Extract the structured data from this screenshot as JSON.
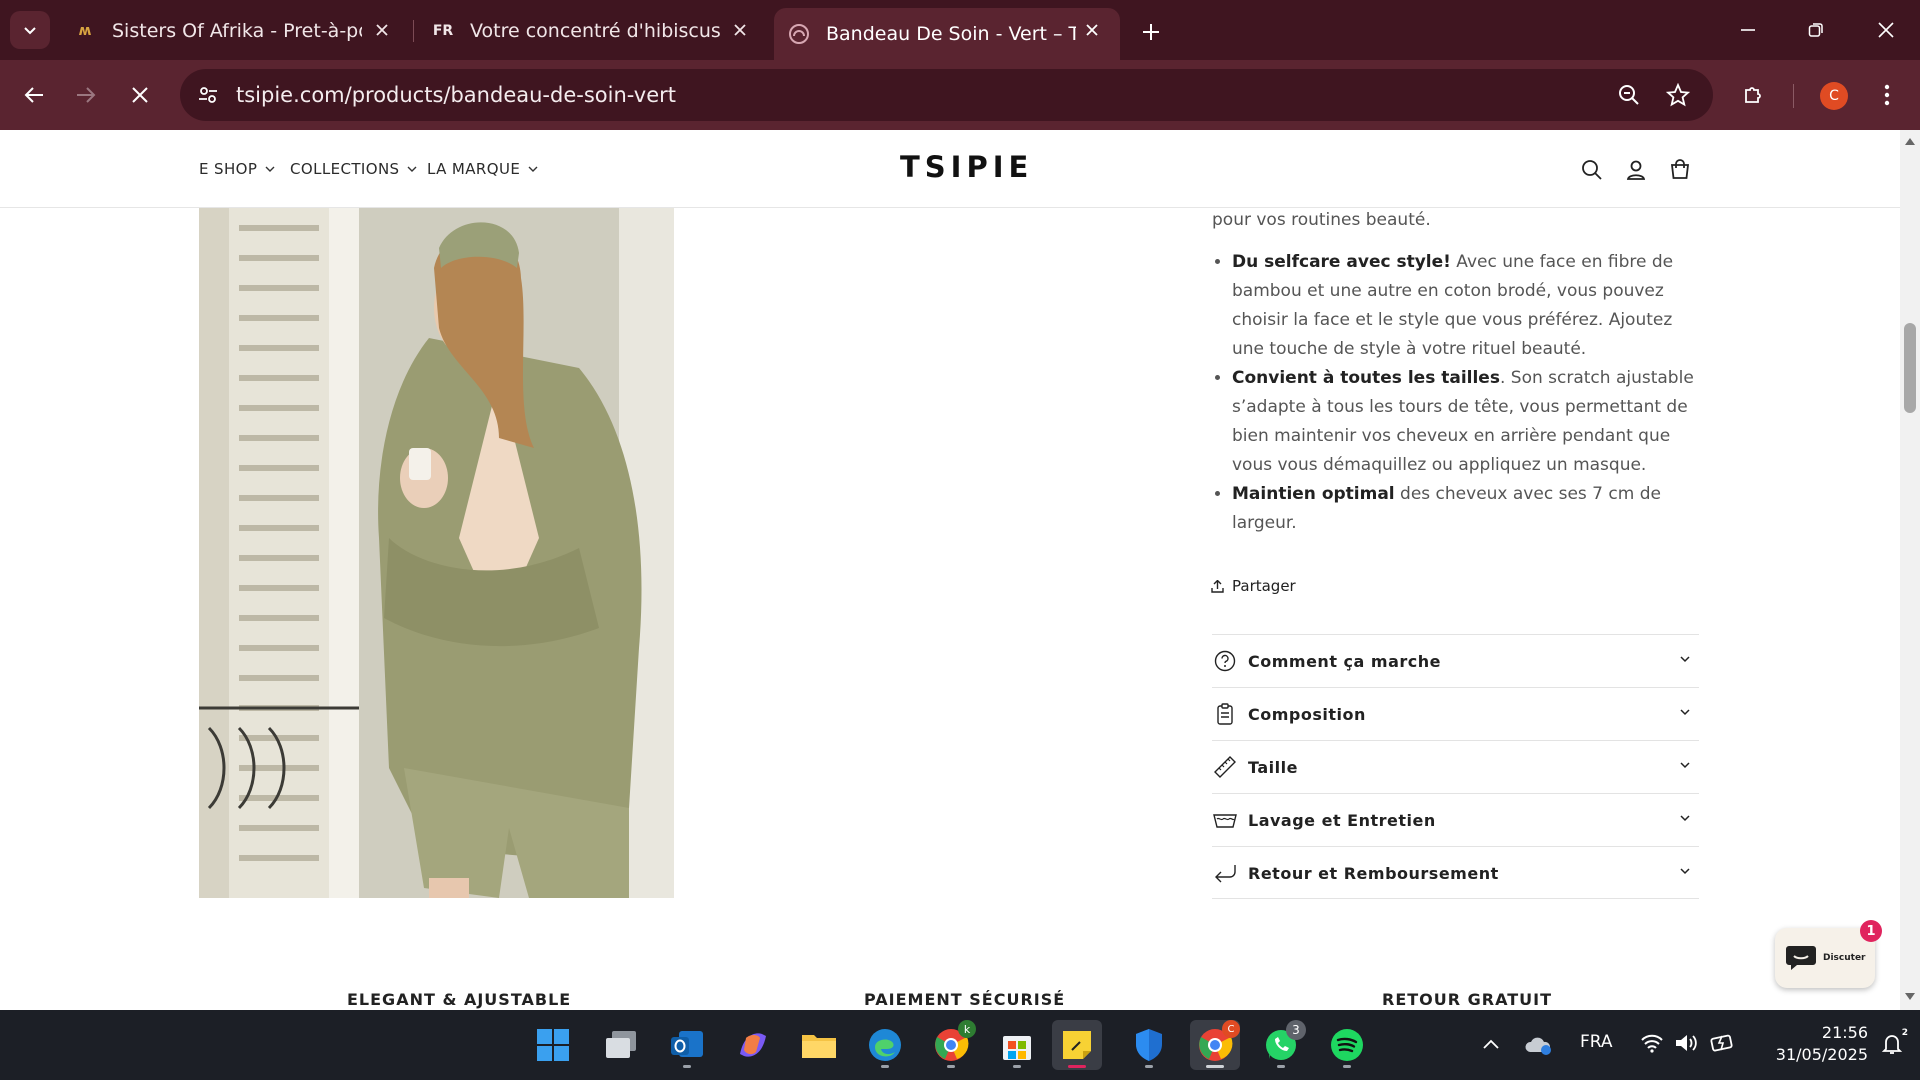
{
  "browser": {
    "tabs": [
      {
        "title": "Sisters Of Afrika - Pret-à-porter",
        "favicon": "sisters-logo-icon"
      },
      {
        "title": "Votre concentré d'hibiscus natu",
        "favicon_text": "FR"
      },
      {
        "title": "Bandeau De Soin - Vert – TSIPIE",
        "favicon": "tsipie-icon",
        "active": true
      }
    ],
    "url": "tsipie.com/products/bandeau-de-soin-vert",
    "profile_initial": "C",
    "accent": "#5a2430"
  },
  "site": {
    "logo": "TSIPIE",
    "nav": [
      "E SHOP",
      "COLLECTIONS",
      "LA MARQUE"
    ]
  },
  "product": {
    "intro": "pour vos routines beauté.",
    "features": [
      {
        "bold": "Du selfcare avec style!",
        "text": " Avec une face en fibre de bambou et une autre en coton brodé, vous pouvez choisir la face et le style que vous préférez. Ajoutez une touche de style à votre rituel beauté."
      },
      {
        "bold": "Convient à toutes les tailles",
        "text": ". Son scratch ajustable s’adapte à tous les tours de tête, vous permettant de bien maintenir vos cheveux en arrière pendant que vous vous démaquillez ou appliquez un masque."
      },
      {
        "bold": "Maintien optimal",
        "text": " des cheveux avec ses 7 cm de largeur."
      }
    ],
    "share": "Partager",
    "accordions": [
      {
        "label": "Comment ça marche",
        "icon": "question-circle-icon"
      },
      {
        "label": "Composition",
        "icon": "clipboard-icon"
      },
      {
        "label": "Taille",
        "icon": "ruler-icon"
      },
      {
        "label": "Lavage et Entretien",
        "icon": "washing-basin-icon"
      },
      {
        "label": "Retour et Remboursement",
        "icon": "return-arrow-icon"
      }
    ]
  },
  "badges": [
    "ELEGANT & AJUSTABLE",
    "PAIEMENT SÉCURISÉ",
    "RETOUR GRATUIT"
  ],
  "chat": {
    "label": "Discuter",
    "count": "1"
  },
  "taskbar": {
    "whatsapp_count": "3",
    "chrome_k_badge": "k",
    "chrome_c_badge": "C",
    "language": "FRA",
    "time": "21:56",
    "date": "31/05/2025",
    "notif_badge": "2"
  }
}
